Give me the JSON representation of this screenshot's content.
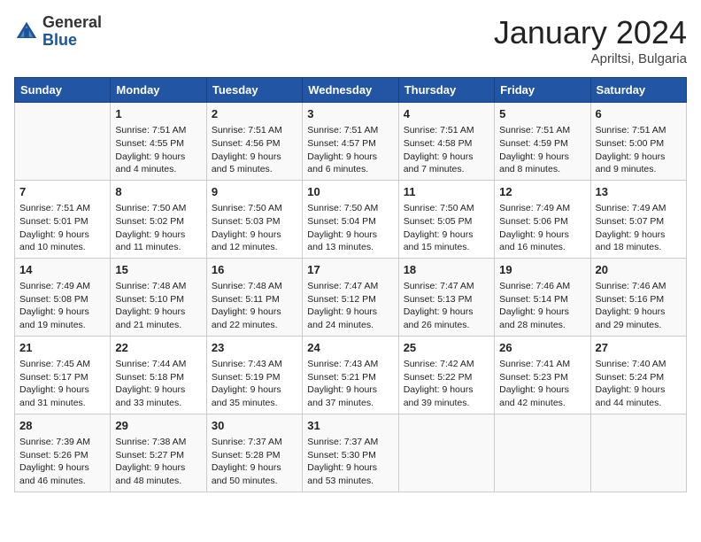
{
  "header": {
    "logo_general": "General",
    "logo_blue": "Blue",
    "month_year": "January 2024",
    "location": "Apriltsi, Bulgaria"
  },
  "weekdays": [
    "Sunday",
    "Monday",
    "Tuesday",
    "Wednesday",
    "Thursday",
    "Friday",
    "Saturday"
  ],
  "weeks": [
    [
      {
        "day": "",
        "info": ""
      },
      {
        "day": "1",
        "info": "Sunrise: 7:51 AM\nSunset: 4:55 PM\nDaylight: 9 hours\nand 4 minutes."
      },
      {
        "day": "2",
        "info": "Sunrise: 7:51 AM\nSunset: 4:56 PM\nDaylight: 9 hours\nand 5 minutes."
      },
      {
        "day": "3",
        "info": "Sunrise: 7:51 AM\nSunset: 4:57 PM\nDaylight: 9 hours\nand 6 minutes."
      },
      {
        "day": "4",
        "info": "Sunrise: 7:51 AM\nSunset: 4:58 PM\nDaylight: 9 hours\nand 7 minutes."
      },
      {
        "day": "5",
        "info": "Sunrise: 7:51 AM\nSunset: 4:59 PM\nDaylight: 9 hours\nand 8 minutes."
      },
      {
        "day": "6",
        "info": "Sunrise: 7:51 AM\nSunset: 5:00 PM\nDaylight: 9 hours\nand 9 minutes."
      }
    ],
    [
      {
        "day": "7",
        "info": "Sunrise: 7:51 AM\nSunset: 5:01 PM\nDaylight: 9 hours\nand 10 minutes."
      },
      {
        "day": "8",
        "info": "Sunrise: 7:50 AM\nSunset: 5:02 PM\nDaylight: 9 hours\nand 11 minutes."
      },
      {
        "day": "9",
        "info": "Sunrise: 7:50 AM\nSunset: 5:03 PM\nDaylight: 9 hours\nand 12 minutes."
      },
      {
        "day": "10",
        "info": "Sunrise: 7:50 AM\nSunset: 5:04 PM\nDaylight: 9 hours\nand 13 minutes."
      },
      {
        "day": "11",
        "info": "Sunrise: 7:50 AM\nSunset: 5:05 PM\nDaylight: 9 hours\nand 15 minutes."
      },
      {
        "day": "12",
        "info": "Sunrise: 7:49 AM\nSunset: 5:06 PM\nDaylight: 9 hours\nand 16 minutes."
      },
      {
        "day": "13",
        "info": "Sunrise: 7:49 AM\nSunset: 5:07 PM\nDaylight: 9 hours\nand 18 minutes."
      }
    ],
    [
      {
        "day": "14",
        "info": "Sunrise: 7:49 AM\nSunset: 5:08 PM\nDaylight: 9 hours\nand 19 minutes."
      },
      {
        "day": "15",
        "info": "Sunrise: 7:48 AM\nSunset: 5:10 PM\nDaylight: 9 hours\nand 21 minutes."
      },
      {
        "day": "16",
        "info": "Sunrise: 7:48 AM\nSunset: 5:11 PM\nDaylight: 9 hours\nand 22 minutes."
      },
      {
        "day": "17",
        "info": "Sunrise: 7:47 AM\nSunset: 5:12 PM\nDaylight: 9 hours\nand 24 minutes."
      },
      {
        "day": "18",
        "info": "Sunrise: 7:47 AM\nSunset: 5:13 PM\nDaylight: 9 hours\nand 26 minutes."
      },
      {
        "day": "19",
        "info": "Sunrise: 7:46 AM\nSunset: 5:14 PM\nDaylight: 9 hours\nand 28 minutes."
      },
      {
        "day": "20",
        "info": "Sunrise: 7:46 AM\nSunset: 5:16 PM\nDaylight: 9 hours\nand 29 minutes."
      }
    ],
    [
      {
        "day": "21",
        "info": "Sunrise: 7:45 AM\nSunset: 5:17 PM\nDaylight: 9 hours\nand 31 minutes."
      },
      {
        "day": "22",
        "info": "Sunrise: 7:44 AM\nSunset: 5:18 PM\nDaylight: 9 hours\nand 33 minutes."
      },
      {
        "day": "23",
        "info": "Sunrise: 7:43 AM\nSunset: 5:19 PM\nDaylight: 9 hours\nand 35 minutes."
      },
      {
        "day": "24",
        "info": "Sunrise: 7:43 AM\nSunset: 5:21 PM\nDaylight: 9 hours\nand 37 minutes."
      },
      {
        "day": "25",
        "info": "Sunrise: 7:42 AM\nSunset: 5:22 PM\nDaylight: 9 hours\nand 39 minutes."
      },
      {
        "day": "26",
        "info": "Sunrise: 7:41 AM\nSunset: 5:23 PM\nDaylight: 9 hours\nand 42 minutes."
      },
      {
        "day": "27",
        "info": "Sunrise: 7:40 AM\nSunset: 5:24 PM\nDaylight: 9 hours\nand 44 minutes."
      }
    ],
    [
      {
        "day": "28",
        "info": "Sunrise: 7:39 AM\nSunset: 5:26 PM\nDaylight: 9 hours\nand 46 minutes."
      },
      {
        "day": "29",
        "info": "Sunrise: 7:38 AM\nSunset: 5:27 PM\nDaylight: 9 hours\nand 48 minutes."
      },
      {
        "day": "30",
        "info": "Sunrise: 7:37 AM\nSunset: 5:28 PM\nDaylight: 9 hours\nand 50 minutes."
      },
      {
        "day": "31",
        "info": "Sunrise: 7:37 AM\nSunset: 5:30 PM\nDaylight: 9 hours\nand 53 minutes."
      },
      {
        "day": "",
        "info": ""
      },
      {
        "day": "",
        "info": ""
      },
      {
        "day": "",
        "info": ""
      }
    ]
  ]
}
